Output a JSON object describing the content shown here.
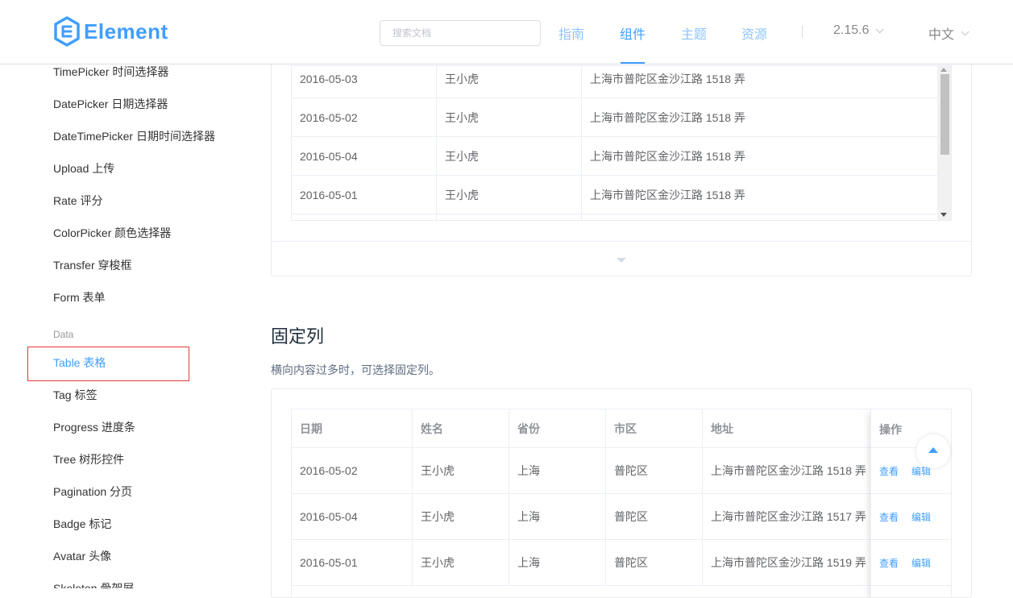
{
  "header": {
    "logo_text": "Element",
    "search_placeholder": "搜索文档",
    "nav": [
      "指南",
      "组件",
      "主题",
      "资源"
    ],
    "active_nav": "组件",
    "version": "2.15.6",
    "language": "中文",
    "accent_color": "#409eff"
  },
  "sidebar": {
    "items_top": [
      "TimePicker 时间选择器",
      "DatePicker 日期选择器",
      "DateTimePicker 日期时间选择器",
      "Upload 上传",
      "Rate 评分",
      "ColorPicker 颜色选择器",
      "Transfer 穿梭框",
      "Form 表单"
    ],
    "group_label": "Data",
    "items_data": [
      "Table 表格",
      "Tag 标签",
      "Progress 进度条",
      "Tree 树形控件",
      "Pagination 分页",
      "Badge 标记",
      "Avatar 头像",
      "Skeleton 骨架屏"
    ],
    "active_item": "Table 表格"
  },
  "demo1": {
    "rows": [
      {
        "date": "2016-05-03",
        "name": "王小虎",
        "address": "上海市普陀区金沙江路 1518 弄"
      },
      {
        "date": "2016-05-02",
        "name": "王小虎",
        "address": "上海市普陀区金沙江路 1518 弄"
      },
      {
        "date": "2016-05-04",
        "name": "王小虎",
        "address": "上海市普陀区金沙江路 1518 弄"
      },
      {
        "date": "2016-05-01",
        "name": "王小虎",
        "address": "上海市普陀区金沙江路 1518 弄"
      }
    ]
  },
  "section": {
    "title": "固定列",
    "description": "横向内容过多时，可选择固定列。"
  },
  "demo2": {
    "headers": {
      "date": "日期",
      "name": "姓名",
      "province": "省份",
      "city": "市区",
      "address": "地址",
      "action": "操作"
    },
    "rows": [
      {
        "date": "2016-05-02",
        "name": "王小虎",
        "province": "上海",
        "city": "普陀区",
        "address": "上海市普陀区金沙江路 1518 弄",
        "view": "查看",
        "edit": "编辑"
      },
      {
        "date": "2016-05-04",
        "name": "王小虎",
        "province": "上海",
        "city": "普陀区",
        "address": "上海市普陀区金沙江路 1517 弄",
        "view": "查看",
        "edit": "编辑"
      },
      {
        "date": "2016-05-01",
        "name": "王小虎",
        "province": "上海",
        "city": "普陀区",
        "address": "上海市普陀区金沙江路 1519 弄",
        "view": "查看",
        "edit": "编辑"
      }
    ]
  }
}
